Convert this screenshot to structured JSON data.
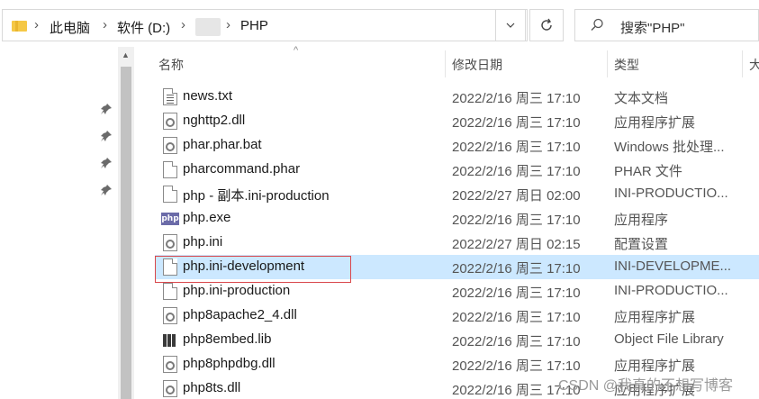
{
  "breadcrumb": [
    "此电脑",
    "软件 (D:)",
    "PHP"
  ],
  "search": {
    "placeholder": "搜索\"PHP\""
  },
  "columns": {
    "name": "名称",
    "date": "修改日期",
    "type": "类型",
    "size_partial": "大"
  },
  "files": [
    {
      "name": "news.txt",
      "date": "2022/2/16 周三 17:10",
      "type": "文本文档",
      "icon": "text-file-icon"
    },
    {
      "name": "nghttp2.dll",
      "date": "2022/2/16 周三 17:10",
      "type": "应用程序扩展",
      "icon": "dll-file-icon"
    },
    {
      "name": "phar.phar.bat",
      "date": "2022/2/16 周三 17:10",
      "type": "Windows 批处理...",
      "icon": "batch-file-icon"
    },
    {
      "name": "pharcommand.phar",
      "date": "2022/2/16 周三 17:10",
      "type": "PHAR 文件",
      "icon": "generic-file-icon"
    },
    {
      "name": "php - 副本.ini-production",
      "date": "2022/2/27 周日 02:00",
      "type": "INI-PRODUCTIO...",
      "icon": "generic-file-icon"
    },
    {
      "name": "php.exe",
      "date": "2022/2/16 周三 17:10",
      "type": "应用程序",
      "icon": "php-exe-icon"
    },
    {
      "name": "php.ini",
      "date": "2022/2/27 周日 02:15",
      "type": "配置设置",
      "icon": "ini-file-icon"
    },
    {
      "name": "php.ini-development",
      "date": "2022/2/16 周三 17:10",
      "type": "INI-DEVELOPME...",
      "icon": "generic-file-icon",
      "selected": true
    },
    {
      "name": "php.ini-production",
      "date": "2022/2/16 周三 17:10",
      "type": "INI-PRODUCTIO...",
      "icon": "generic-file-icon"
    },
    {
      "name": "php8apache2_4.dll",
      "date": "2022/2/16 周三 17:10",
      "type": "应用程序扩展",
      "icon": "dll-file-icon"
    },
    {
      "name": "php8embed.lib",
      "date": "2022/2/16 周三 17:10",
      "type": "Object File Library",
      "icon": "lib-file-icon"
    },
    {
      "name": "php8phpdbg.dll",
      "date": "2022/2/16 周三 17:10",
      "type": "应用程序扩展",
      "icon": "dll-file-icon"
    },
    {
      "name": "php8ts.dll",
      "date": "2022/2/16 周三 17:10",
      "type": "应用程序扩展",
      "icon": "dll-file-icon"
    }
  ],
  "watermark": "CSDN @我真的不想写博客",
  "colors": {
    "selected_row": "#cce8ff",
    "highlight_border": "#d9474b",
    "folder": "#f5c846"
  }
}
